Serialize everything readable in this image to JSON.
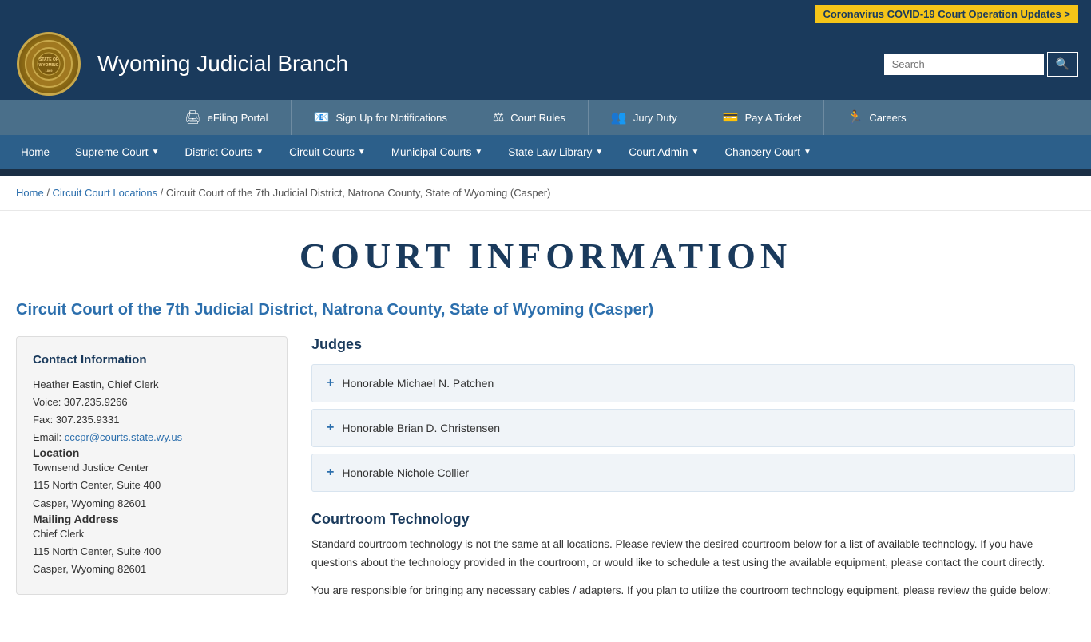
{
  "covid_banner": {
    "text": "Coronavirus COVID-19 Court Operation Updates >"
  },
  "header": {
    "title": "Wyoming Judicial Branch",
    "search_placeholder": "Search"
  },
  "quick_links": [
    {
      "label": "eFiling Portal",
      "icon": "🖨"
    },
    {
      "label": "Sign Up for Notifications",
      "icon": "📧"
    },
    {
      "label": "Court Rules",
      "icon": "⚖"
    },
    {
      "label": "Jury Duty",
      "icon": "👥"
    },
    {
      "label": "Pay A Ticket",
      "icon": "💳"
    },
    {
      "label": "Careers",
      "icon": "🏃"
    }
  ],
  "main_nav": [
    {
      "label": "Home",
      "has_dropdown": false
    },
    {
      "label": "Supreme Court",
      "has_dropdown": true
    },
    {
      "label": "District Courts",
      "has_dropdown": true
    },
    {
      "label": "Circuit Courts",
      "has_dropdown": true
    },
    {
      "label": "Municipal Courts",
      "has_dropdown": true
    },
    {
      "label": "State Law Library",
      "has_dropdown": true
    },
    {
      "label": "Court Admin",
      "has_dropdown": true
    },
    {
      "label": "Chancery Court",
      "has_dropdown": true
    }
  ],
  "breadcrumb": {
    "items": [
      {
        "label": "Home",
        "link": true
      },
      {
        "label": "Circuit Court Locations",
        "link": true
      },
      {
        "label": "Circuit Court of the 7th Judicial District, Natrona County, State of Wyoming (Casper)",
        "link": false
      }
    ]
  },
  "page": {
    "title": "COURT INFORMATION",
    "court_name": "Circuit Court of the 7th Judicial District, Natrona County, State of Wyoming (Casper)"
  },
  "contact": {
    "section_title": "Contact Information",
    "chief_clerk": "Heather Eastin, Chief Clerk",
    "voice": "Voice: 307.235.9266",
    "fax": "Fax: 307.235.9331",
    "email_label": "Email: ",
    "email": "cccpr@courts.state.wy.us",
    "location_title": "Location",
    "location_line1": "Townsend Justice Center",
    "location_line2": "115 North Center, Suite 400",
    "location_line3": "Casper, Wyoming 82601",
    "mailing_title": "Mailing Address",
    "mailing_line1": "Chief Clerk",
    "mailing_line2": "115 North Center, Suite 400",
    "mailing_line3": "Casper, Wyoming 82601"
  },
  "judges": {
    "section_title": "Judges",
    "items": [
      {
        "name": "Honorable Michael N. Patchen"
      },
      {
        "name": "Honorable Brian D. Christensen"
      },
      {
        "name": "Honorable Nichole Collier"
      }
    ]
  },
  "courtroom_tech": {
    "section_title": "Courtroom Technology",
    "paragraph1": "Standard courtroom technology is not the same at all locations. Please review the desired courtroom below for a list of available technology. If you have questions about the technology provided in the courtroom, or would like to schedule a test using the available equipment, please contact the court directly.",
    "paragraph2": "You are responsible for bringing any necessary cables / adapters. If you plan to utilize the courtroom technology equipment, please review the guide below:"
  }
}
